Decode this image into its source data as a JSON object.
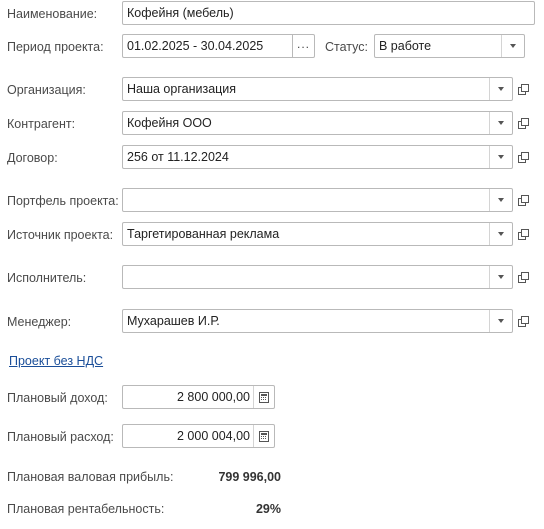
{
  "name": {
    "label": "Наименование:",
    "value": "Кофейня (мебель)"
  },
  "period": {
    "label": "Период проекта:",
    "value": "01.02.2025 - 30.04.2025",
    "picker_label": "..."
  },
  "status": {
    "label": "Статус:",
    "value": "В работе"
  },
  "organization": {
    "label": "Организация:",
    "value": "Наша организация"
  },
  "counterparty": {
    "label": "Контрагент:",
    "value": "Кофейня ООО"
  },
  "contract": {
    "label": "Договор:",
    "value": "256 от 11.12.2024"
  },
  "portfolio": {
    "label": "Портфель проекта:",
    "value": ""
  },
  "source": {
    "label": "Источник проекта:",
    "value": "Таргетированная реклама"
  },
  "executor": {
    "label": "Исполнитель:",
    "value": ""
  },
  "manager": {
    "label": "Менеджер:",
    "value": "Мухарашев И.Р."
  },
  "vat_link": "Проект без НДС",
  "planned_income": {
    "label": "Плановый доход:",
    "value": "2 800 000,00"
  },
  "planned_expense": {
    "label": "Плановый расход:",
    "value": "2 000 004,00"
  },
  "gross_profit": {
    "label": "Плановая валовая прибыль:",
    "value": "799 996,00"
  },
  "profitability": {
    "label": "Плановая рентабельность:",
    "value": "29%"
  },
  "icons": {
    "dropdown": "chevron-down-icon",
    "open": "open-form-icon",
    "calculator": "calculator-icon"
  }
}
